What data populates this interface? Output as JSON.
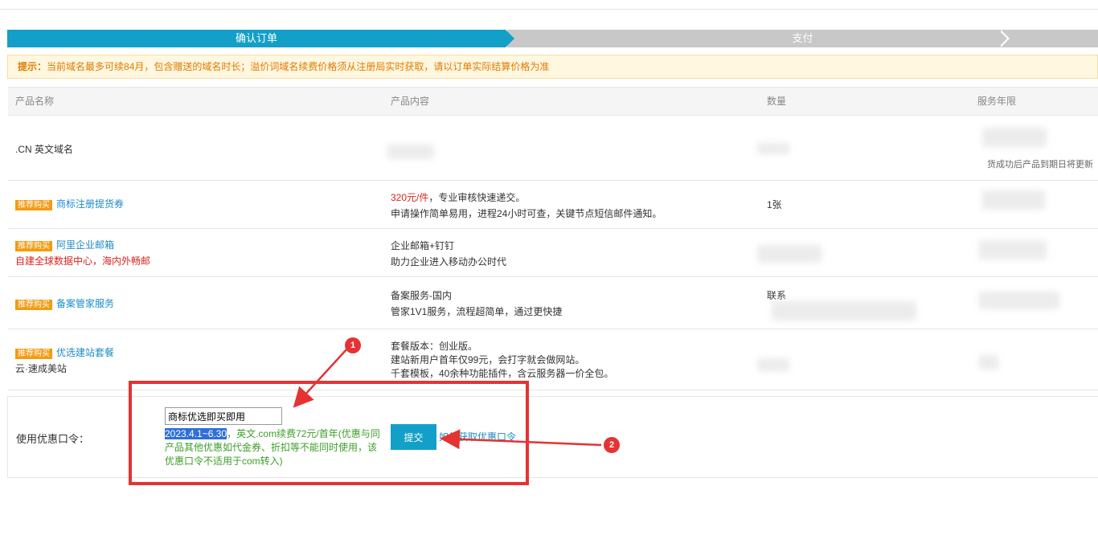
{
  "steps": {
    "active": "确认订单",
    "next": "支付"
  },
  "notice": {
    "prefix": "提示：",
    "text": "当前域名最多可续84月，包含赠送的域名时长；溢价词域名续费价格须从注册局实时获取，请以订单实际结算价格为准"
  },
  "table": {
    "headers": [
      "产品名称",
      "产品内容",
      "数量",
      "服务年限"
    ],
    "rows": [
      {
        "name": ".CN 英文域名",
        "content_blurred": true,
        "service_note": "货成功后产品到期日将更新"
      },
      {
        "tag": "推荐购买",
        "name": "商标注册提货券",
        "content_price": "320元/件",
        "content_line1_rest": "，专业审核快速递交。",
        "content_line2": "申请操作简单易用，进程24小时可查，关键节点短信邮件通知。",
        "quantity": "1张"
      },
      {
        "tag": "推荐购买",
        "name": "阿里企业邮箱",
        "sub": "自建全球数据中心，海内外畅邮",
        "content_line1": "企业邮箱+钉钉",
        "content_line2": "助力企业进入移动办公时代"
      },
      {
        "tag": "推荐购买",
        "name": "备案管家服务",
        "content_line1": "备案服务-国内",
        "content_line2": "管家1V1服务，流程超简单，通过更快捷",
        "quantity": "联系"
      },
      {
        "tag": "推荐购买",
        "name": "优选建站套餐",
        "sub": "云·速成美站",
        "content_line1": "套餐版本：创业版。",
        "content_line2": "建站新用户首年仅99元，会打字就会做网站。",
        "content_line3": "千套模板，40余种功能插件，含云服务器一价全包。"
      }
    ]
  },
  "coupon": {
    "label": "使用优惠口令：",
    "input_value": "商标优选即买即用",
    "note_highlight": "2023.4.1~6.30",
    "note_rest": "，英文.com续费72元/首年(优惠与同产品其他优惠如代金券、折扣等不能同时使用，该优惠口令不适用于com转入)",
    "submit_label": "提交",
    "how_link": "如何获取优惠口令"
  },
  "annotations": {
    "badge1": "1",
    "badge2": "2",
    "color": "#e53333"
  },
  "colors": {
    "primary": "#12a0c8",
    "tag": "#f39b12",
    "notice_text": "#e27a00",
    "coupon_note": "#3c9e2a",
    "link": "#1a8cc8"
  }
}
